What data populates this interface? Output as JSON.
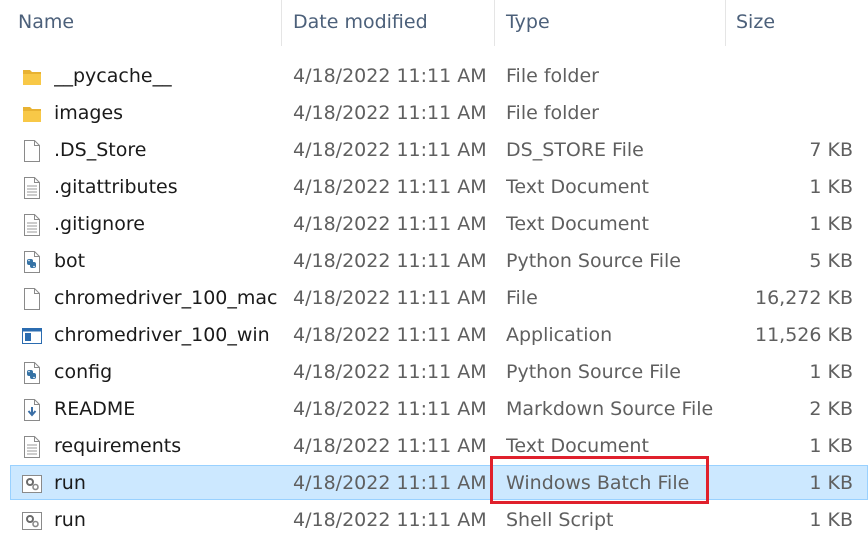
{
  "columns": {
    "name": "Name",
    "date": "Date modified",
    "type": "Type",
    "size": "Size"
  },
  "files": [
    {
      "name": "__pycache__",
      "date": "4/18/2022 11:11 AM",
      "type": "File folder",
      "size": "",
      "icon": "folder-icon"
    },
    {
      "name": "images",
      "date": "4/18/2022 11:11 AM",
      "type": "File folder",
      "size": "",
      "icon": "folder-icon"
    },
    {
      "name": ".DS_Store",
      "date": "4/18/2022 11:11 AM",
      "type": "DS_STORE File",
      "size": "7 KB",
      "icon": "blank-file-icon"
    },
    {
      "name": ".gitattributes",
      "date": "4/18/2022 11:11 AM",
      "type": "Text Document",
      "size": "1 KB",
      "icon": "text-file-icon"
    },
    {
      "name": ".gitignore",
      "date": "4/18/2022 11:11 AM",
      "type": "Text Document",
      "size": "1 KB",
      "icon": "text-file-icon"
    },
    {
      "name": "bot",
      "date": "4/18/2022 11:11 AM",
      "type": "Python Source File",
      "size": "5 KB",
      "icon": "python-file-icon"
    },
    {
      "name": "chromedriver_100_mac",
      "date": "4/18/2022 11:11 AM",
      "type": "File",
      "size": "16,272 KB",
      "icon": "blank-file-icon"
    },
    {
      "name": "chromedriver_100_win",
      "date": "4/18/2022 11:11 AM",
      "type": "Application",
      "size": "11,526 KB",
      "icon": "application-icon"
    },
    {
      "name": "config",
      "date": "4/18/2022 11:11 AM",
      "type": "Python Source File",
      "size": "1 KB",
      "icon": "python-file-icon"
    },
    {
      "name": "README",
      "date": "4/18/2022 11:11 AM",
      "type": "Markdown Source File",
      "size": "2 KB",
      "icon": "markdown-file-icon"
    },
    {
      "name": "requirements",
      "date": "4/18/2022 11:11 AM",
      "type": "Text Document",
      "size": "1 KB",
      "icon": "text-file-icon"
    },
    {
      "name": "run",
      "date": "4/18/2022 11:11 AM",
      "type": "Windows Batch File",
      "size": "1 KB",
      "icon": "batch-file-icon",
      "selected": true
    },
    {
      "name": "run",
      "date": "4/18/2022 11:11 AM",
      "type": "Shell Script",
      "size": "1 KB",
      "icon": "script-file-icon"
    }
  ],
  "colors": {
    "selection": "#cce8ff",
    "highlight_border": "#e0202c",
    "folder": "#f8c847"
  }
}
